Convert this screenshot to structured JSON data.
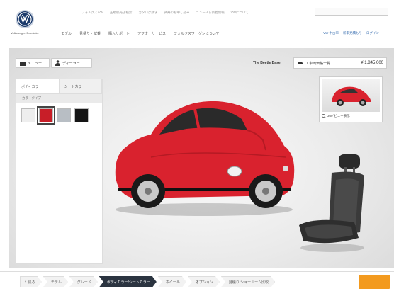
{
  "header": {
    "brand_label": "Volkswagen Das Auto.",
    "util_links": [
      "フォルクス VW",
      "正規販売店検索",
      "カタログ請求",
      "試乗のお申し込み",
      "ニュース＆新着情報",
      "VWについて"
    ],
    "main_nav": [
      "モデル",
      "見積り・試乗",
      "購入サポート",
      "アフターサービス",
      "フォルクスワーゲンについて"
    ],
    "right_links": [
      "VW 中古車",
      "新車見積もり",
      "ログイン"
    ]
  },
  "toolbar": {
    "menu_label": "メニュー",
    "dealer_label": "ディーラー",
    "model_name": "The Beetle Base",
    "price_prefix": "1 車両価格一覧",
    "price_value": "¥ 1,845,000"
  },
  "color_panel": {
    "tab_exterior": "ボディカラー",
    "tab_interior": "シートカラー",
    "section_label": "カラータイプ",
    "swatches": [
      {
        "name": "white",
        "color": "#eeeeee"
      },
      {
        "name": "red",
        "color": "#c81e28"
      },
      {
        "name": "silver",
        "color": "#b8bec4"
      },
      {
        "name": "black",
        "color": "#151515"
      }
    ],
    "selected_index": 1
  },
  "preview": {
    "thumb_label": "360°ビュー表示",
    "car_color": "#d9222e"
  },
  "steps": {
    "back_label": "戻る",
    "items": [
      "モデル",
      "グレード",
      "ボディカラー/シートカラー",
      "ホイール",
      "オプション",
      "見積り/ショールーム比較"
    ],
    "active_index": 2
  },
  "colors": {
    "accent_orange": "#f39a1e",
    "active_step": "#2b3440",
    "brand_blue": "#1b3a6b"
  }
}
